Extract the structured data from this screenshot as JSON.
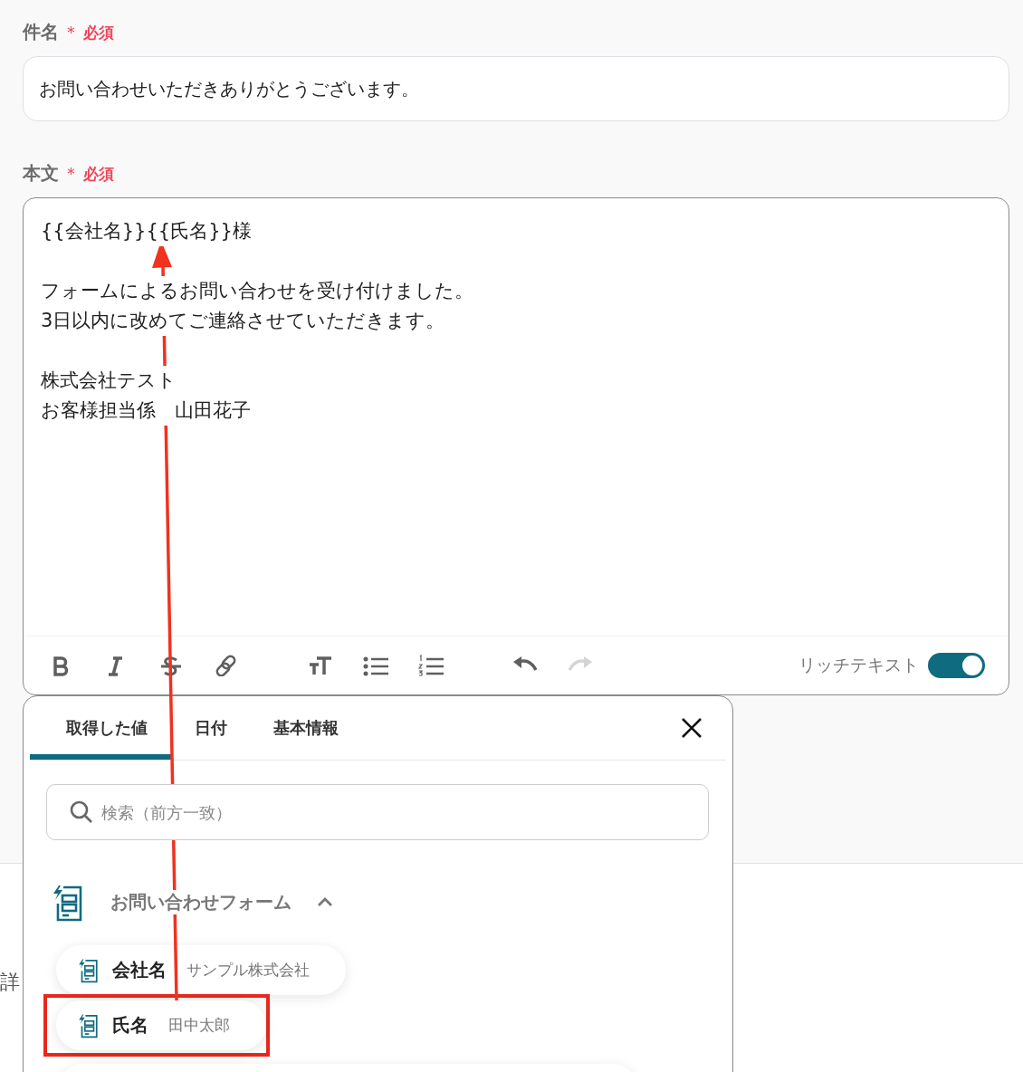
{
  "subject": {
    "label": "件名",
    "required_mark": "＊",
    "required_text": "必須",
    "value": "お問い合わせいただきありがとうございます。"
  },
  "body": {
    "label": "本文",
    "required_mark": "＊",
    "required_text": "必須",
    "paragraphs": [
      [
        "{{会社名}}{{氏名}}様"
      ],
      [
        "フォームによるお問い合わせを受け付けました。",
        "3日以内に改めてご連絡させていただきます。"
      ],
      [
        "株式会社テスト",
        "お客様担当係　山田花子"
      ]
    ]
  },
  "toolbar": {
    "groups": [
      [
        {
          "kind": "bold",
          "disabled": false
        },
        {
          "kind": "italic",
          "disabled": false
        },
        {
          "kind": "strike",
          "disabled": false
        },
        {
          "kind": "link",
          "disabled": false
        }
      ],
      [
        {
          "kind": "text-size",
          "disabled": false
        },
        {
          "kind": "bullet-list",
          "disabled": false
        },
        {
          "kind": "numbered-list",
          "disabled": false
        }
      ],
      [
        {
          "kind": "undo",
          "disabled": false
        },
        {
          "kind": "redo",
          "disabled": true
        }
      ]
    ],
    "rich_text": {
      "label": "リッチテキスト",
      "on": true
    }
  },
  "popup": {
    "tabs": [
      {
        "label": "取得した値",
        "selected": true
      },
      {
        "label": "日付",
        "selected": false
      },
      {
        "label": "基本情報",
        "selected": false
      }
    ],
    "search": {
      "placeholder": "検索（前方一致）"
    },
    "group": {
      "title": "お問い合わせフォーム",
      "expanded": true,
      "items": [
        {
          "name": "会社名",
          "value": "サンプル株式会社",
          "highlighted": false
        },
        {
          "name": "氏名",
          "value": "田中太郎",
          "highlighted": true
        }
      ]
    }
  },
  "section_label": "詳"
}
